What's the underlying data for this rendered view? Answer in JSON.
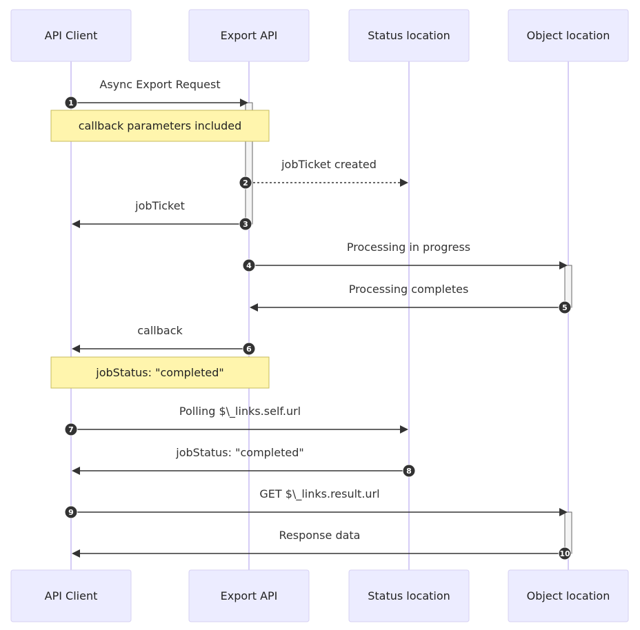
{
  "diagram": {
    "type": "sequence",
    "actors": [
      {
        "id": "client",
        "label": "API Client"
      },
      {
        "id": "export",
        "label": "Export API"
      },
      {
        "id": "status",
        "label": "Status location"
      },
      {
        "id": "object",
        "label": "Object location"
      }
    ],
    "steps": [
      {
        "kind": "message",
        "seq": "1",
        "from": "client",
        "to": "export",
        "label": "Async Export Request",
        "style": "solid"
      },
      {
        "kind": "note",
        "over": [
          "client",
          "export"
        ],
        "label": "callback parameters included"
      },
      {
        "kind": "message",
        "seq": "2",
        "from": "export",
        "to": "status",
        "label": "jobTicket created",
        "style": "dotted"
      },
      {
        "kind": "message",
        "seq": "3",
        "from": "export",
        "to": "client",
        "label": "jobTicket",
        "style": "solid"
      },
      {
        "kind": "message",
        "seq": "4",
        "from": "export",
        "to": "object",
        "label": "Processing in progress",
        "style": "solid"
      },
      {
        "kind": "message",
        "seq": "5",
        "from": "object",
        "to": "export",
        "label": "Processing completes",
        "style": "solid"
      },
      {
        "kind": "message",
        "seq": "6",
        "from": "export",
        "to": "client",
        "label": "callback",
        "style": "solid"
      },
      {
        "kind": "note",
        "over": [
          "client",
          "export"
        ],
        "label": "jobStatus: \"completed\""
      },
      {
        "kind": "message",
        "seq": "7",
        "from": "client",
        "to": "status",
        "label": "Polling $\\_links.self.url",
        "style": "solid"
      },
      {
        "kind": "message",
        "seq": "8",
        "from": "status",
        "to": "client",
        "label": "jobStatus: \"completed\"",
        "style": "solid"
      },
      {
        "kind": "message",
        "seq": "9",
        "from": "client",
        "to": "object",
        "label": "GET $\\_links.result.url",
        "style": "solid"
      },
      {
        "kind": "message",
        "seq": "10",
        "from": "object",
        "to": "client",
        "label": "Response data",
        "style": "solid"
      }
    ],
    "activations": [
      {
        "actor": "export",
        "from_seq": "1",
        "to_seq": "3"
      },
      {
        "actor": "object",
        "from_seq": "4",
        "to_seq": "5"
      },
      {
        "actor": "object",
        "from_seq": "9",
        "to_seq": "10"
      }
    ]
  }
}
